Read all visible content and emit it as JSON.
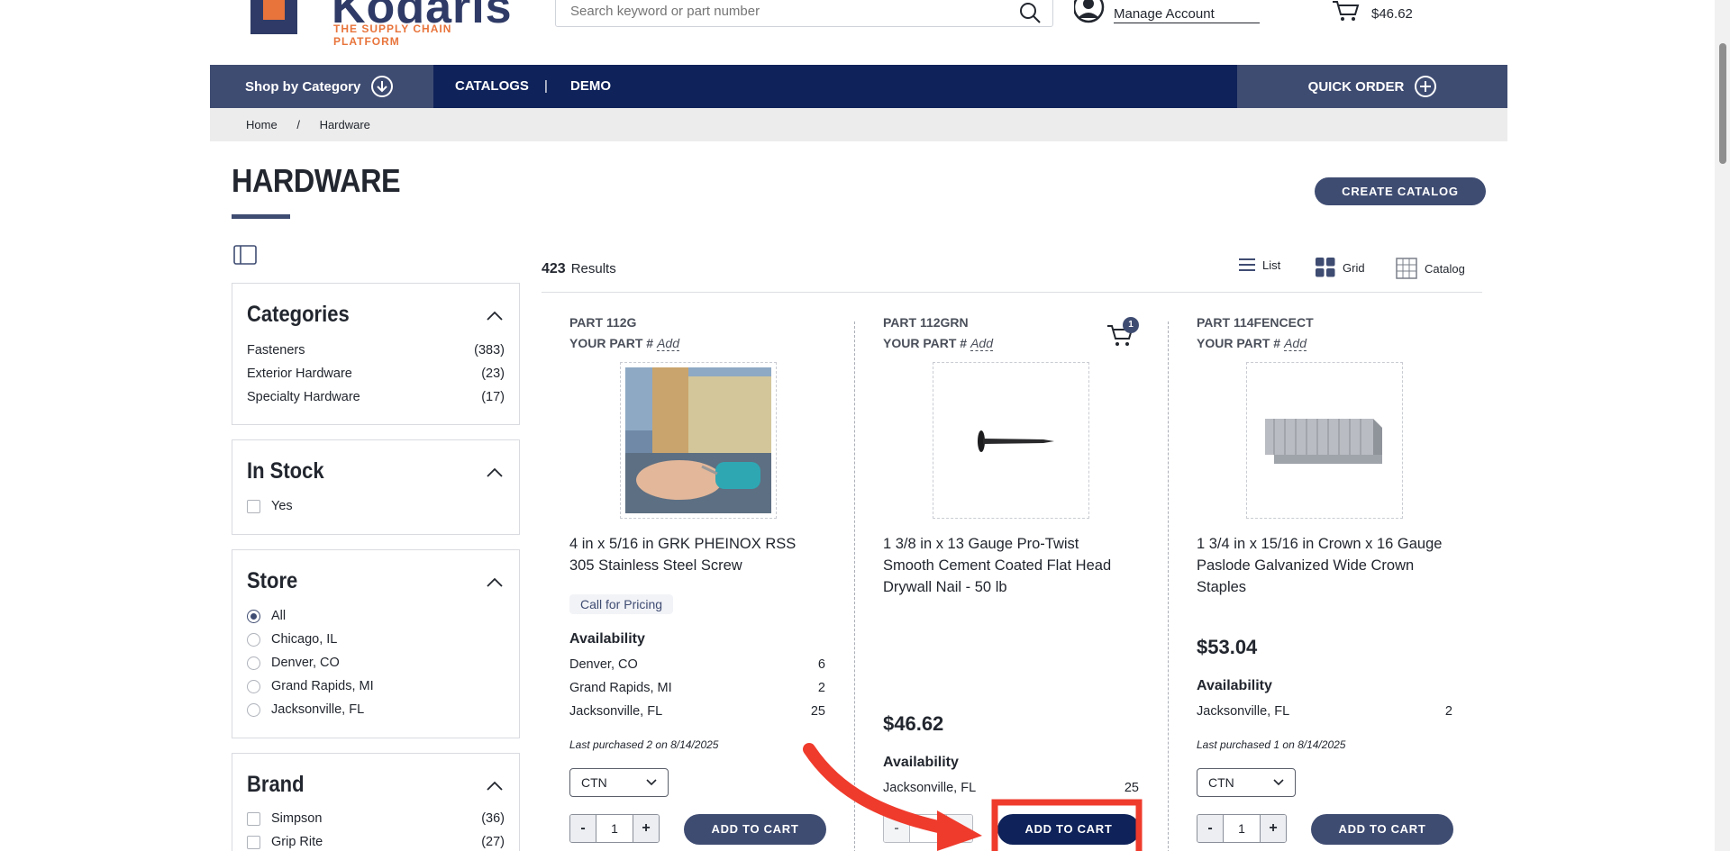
{
  "brand": {
    "name": "Kodaris",
    "tagline": "THE SUPPLY CHAIN PLATFORM",
    "colors": {
      "navy": "#0f2259",
      "slate": "#3f4c72",
      "orange": "#e8743b"
    }
  },
  "header": {
    "search_placeholder": "Search keyword or part number",
    "account_label": "Manage Account",
    "cart_total": "$46.62"
  },
  "nav": {
    "shop_by_category": "Shop by Category",
    "catalogs": "CATALOGS",
    "separator": "|",
    "demo": "DEMO",
    "quick_order": "QUICK ORDER"
  },
  "breadcrumb": {
    "home": "Home",
    "sep": "/",
    "current": "Hardware"
  },
  "page": {
    "title": "HARDWARE",
    "create_catalog": "CREATE CATALOG"
  },
  "results": {
    "count": "423",
    "label": "Results",
    "views": {
      "list": "List",
      "grid": "Grid",
      "catalog": "Catalog"
    }
  },
  "filters": {
    "categories": {
      "title": "Categories",
      "items": [
        {
          "label": "Fasteners",
          "count": "(383)"
        },
        {
          "label": "Exterior Hardware",
          "count": "(23)"
        },
        {
          "label": "Specialty Hardware",
          "count": "(17)"
        }
      ]
    },
    "in_stock": {
      "title": "In Stock",
      "option": "Yes"
    },
    "store": {
      "title": "Store",
      "options": [
        "All",
        "Chicago, IL",
        "Denver, CO",
        "Grand Rapids, MI",
        "Jacksonville, FL"
      ],
      "selected": "All"
    },
    "brand": {
      "title": "Brand",
      "items": [
        {
          "label": "Simpson",
          "count": "(36)"
        },
        {
          "label": "Grip Rite",
          "count": "(27)"
        }
      ]
    }
  },
  "products": [
    {
      "part": "PART 112G",
      "your_part_label": "YOUR PART #",
      "your_part_action": "Add",
      "name_1": "4 in x 5/16 in GRK PHEINOX RSS",
      "name_2": "305 Stainless Steel Screw",
      "price_note": "Call for Pricing",
      "availability_label": "Availability",
      "availability": [
        {
          "store": "Denver, CO",
          "qty": "6"
        },
        {
          "store": "Grand Rapids, MI",
          "qty": "2"
        },
        {
          "store": "Jacksonville, FL",
          "qty": "25"
        }
      ],
      "last_purchased": "Last purchased 2 on 8/14/2025",
      "uom": "CTN",
      "qty": "1",
      "add_to_cart": "ADD TO CART",
      "image_icon": "screw-drill-photo"
    },
    {
      "part": "PART 112GRN",
      "your_part_label": "YOUR PART #",
      "your_part_action": "Add",
      "name_1": "1 3/8 in x 13 Gauge Pro-Twist",
      "name_2": "Smooth Cement Coated Flat Head",
      "name_3": "Drywall Nail - 50 lb",
      "price": "$46.62",
      "availability_label": "Availability",
      "availability": [
        {
          "store": "Jacksonville, FL",
          "qty": "25"
        }
      ],
      "cart_badge": "1",
      "add_to_cart": "ADD TO CART",
      "minus": "-",
      "plus": "+",
      "image_icon": "nail-photo"
    },
    {
      "part": "PART 114FENCECT",
      "your_part_label": "YOUR PART #",
      "your_part_action": "Add",
      "name_1": "1 3/4 in x 15/16 in Crown x 16 Gauge",
      "name_2": "Paslode Galvanized Wide Crown",
      "name_3": "Staples",
      "price": "$53.04",
      "availability_label": "Availability",
      "availability": [
        {
          "store": "Jacksonville, FL",
          "qty": "2"
        }
      ],
      "last_purchased": "Last purchased 1 on 8/14/2025",
      "uom": "CTN",
      "qty": "1",
      "add_to_cart": "ADD TO CART",
      "image_icon": "staples-photo"
    }
  ],
  "qty_controls": {
    "minus": "-",
    "plus": "+"
  },
  "annotation": {
    "arrow_color": "#ef3b2c",
    "highlight_target": "ADD TO CART"
  }
}
